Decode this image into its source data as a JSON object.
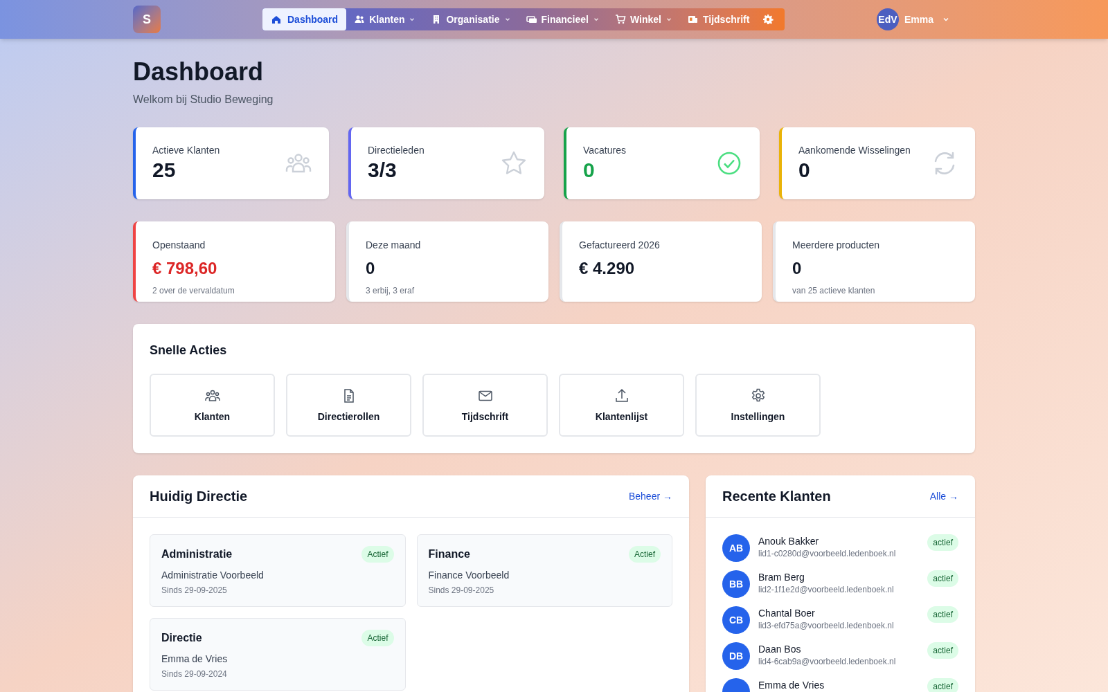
{
  "brand": {
    "letter": "S"
  },
  "nav": [
    {
      "label": "Dashboard",
      "selected": true,
      "dropdown": false
    },
    {
      "label": "Klanten",
      "selected": false,
      "dropdown": true
    },
    {
      "label": "Organisatie",
      "selected": false,
      "dropdown": true
    },
    {
      "label": "Financieel",
      "selected": false,
      "dropdown": true
    },
    {
      "label": "Winkel",
      "selected": false,
      "dropdown": true
    },
    {
      "label": "Tijdschrift",
      "selected": false,
      "dropdown": false
    }
  ],
  "user": {
    "initials": "EdV",
    "name": "Emma"
  },
  "page": {
    "title": "Dashboard",
    "subtitle": "Welkom bij Studio Beweging"
  },
  "stats": [
    {
      "label": "Actieve Klanten",
      "value": "25",
      "color": "#2563eb",
      "kind": "plain"
    },
    {
      "label": "Directieleden",
      "value": "3/3",
      "color": "#6366f1",
      "kind": "plain"
    },
    {
      "label": "Vacatures",
      "value": "0",
      "color": "#16a34a",
      "kind": "positive"
    },
    {
      "label": "Aankomende Wisselingen",
      "value": "0",
      "color": "#eab308",
      "kind": "plain"
    }
  ],
  "finance": [
    {
      "label": "Openstaand",
      "value": "€ 798,60",
      "note": "2 over de vervaldatum",
      "color": "#ef4444",
      "kind": "negative"
    },
    {
      "label": "Deze maand",
      "value": "0",
      "note": "3 erbij, 3 eraf",
      "color": "#e5e7eb",
      "kind": "plain"
    },
    {
      "label": "Gefactureerd 2026",
      "value": "€ 4.290",
      "color": "#e5e7eb",
      "kind": "plain"
    },
    {
      "label": "Meerdere producten",
      "value": "0",
      "note": "van 25 actieve klanten",
      "color": "#e5e7eb",
      "kind": "plain"
    }
  ],
  "quick_actions": {
    "title": "Snelle Acties",
    "items": [
      "Klanten",
      "Directierollen",
      "Tijdschrift",
      "Klantenlijst",
      "Instellingen"
    ]
  },
  "board": {
    "title": "Huidig Directie",
    "link": "Beheer →",
    "roles": [
      {
        "role": "Administratie",
        "status": "Actief",
        "person": "Administratie Voorbeeld",
        "since": "Sinds 29-09-2025"
      },
      {
        "role": "Finance",
        "status": "Actief",
        "person": "Finance Voorbeeld",
        "since": "Sinds 29-09-2025"
      },
      {
        "role": "Directie",
        "status": "Actief",
        "person": "Emma de Vries",
        "since": "Sinds 29-09-2024"
      }
    ]
  },
  "recent": {
    "title": "Recente Klanten",
    "link": "Alle →",
    "clients": [
      {
        "initials": "AB",
        "name": "Anouk Bakker",
        "email": "lid1-c0280d@voorbeeld.ledenboek.nl",
        "status": "actief"
      },
      {
        "initials": "BB",
        "name": "Bram Berg",
        "email": "lid2-1f1e2d@voorbeeld.ledenboek.nl",
        "status": "actief"
      },
      {
        "initials": "CB",
        "name": "Chantal Boer",
        "email": "lid3-efd75a@voorbeeld.ledenboek.nl",
        "status": "actief"
      },
      {
        "initials": "DB",
        "name": "Daan Bos",
        "email": "lid4-6cab9a@voorbeeld.ledenboek.nl",
        "status": "actief"
      },
      {
        "name": "Emma de Vries",
        "status": "actief"
      }
    ]
  }
}
